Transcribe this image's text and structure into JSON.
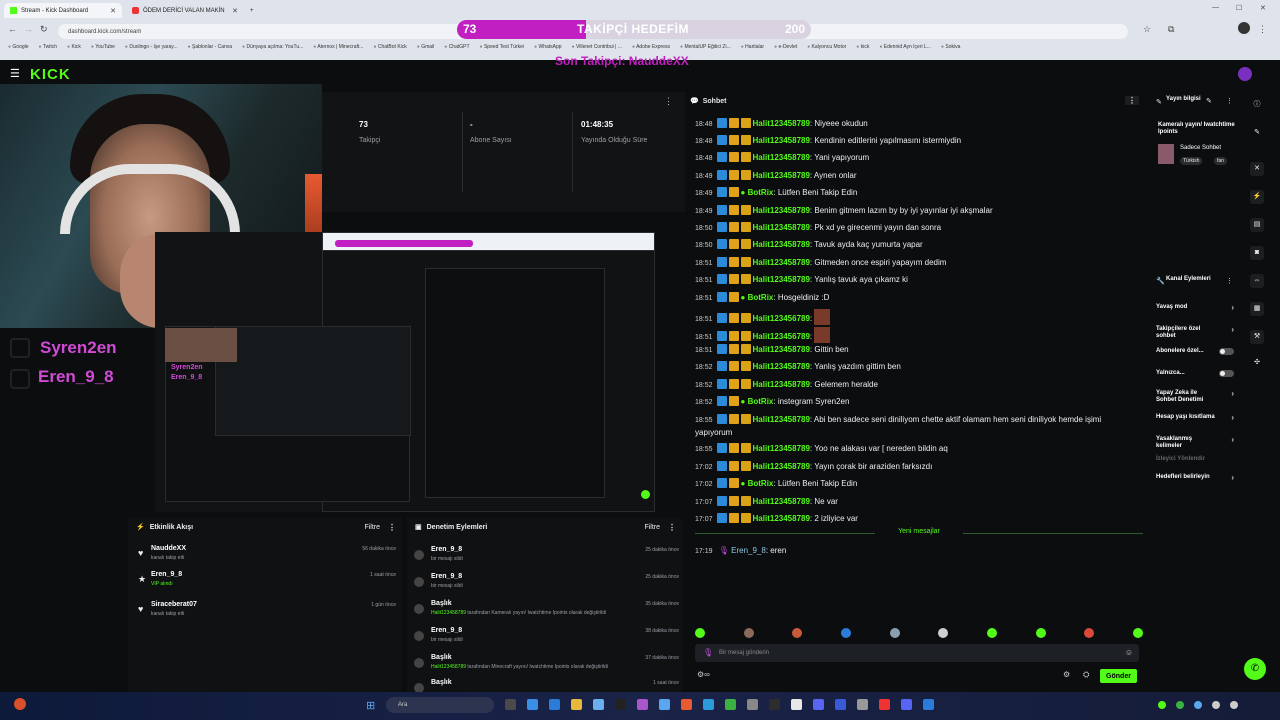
{
  "browser": {
    "tabs": [
      {
        "label": "Stream - Kick Dashboard",
        "active": true
      },
      {
        "label": "ÖDEM DERİCİ VALAN MAKİN",
        "active": false
      }
    ],
    "new_tab": "+",
    "address": "dashboard.kick.com/stream",
    "bookmarks": [
      "Google",
      "Twitch",
      "Kick",
      "YouTube",
      "Duolingo - İşe yaray...",
      "Şablonlar - Canva",
      "Dünyaya açılma: YouTu...",
      "Aternos | Minecraft...",
      "ChatBot Kick",
      "Gmail",
      "ChatGPT",
      "Speed Test Türkei",
      "WhatsApp",
      "Villenet Contribui | ...",
      "Adobe Express",
      "MentalUP Eğitici Zi...",
      "Haritalar",
      "e-Devlet",
      "Kalyoncu Motor",
      "kick",
      "Edennid Ayn İçeri L...",
      "Sokiva"
    ]
  },
  "overlay": {
    "goal_current": "73",
    "goal_label": "TAKİPÇİ HEDEFİM",
    "goal_target": "200",
    "goal_fraction": 0.365,
    "last_follower": "Son Takipçi: NauddeXX",
    "names": [
      "Syren2en",
      "Eren_9_8"
    ]
  },
  "stats": {
    "followers_value": "73",
    "followers_label": "Takipçi",
    "subs_value": "-",
    "subs_label": "Abone Sayısı",
    "uptime_value": "01:48:35",
    "uptime_label": "Yayında Olduğu Süre"
  },
  "activity": {
    "title": "Etkinlik Akışı",
    "filter": "Filtre",
    "items": [
      {
        "name": "NauddeXX",
        "sub": "kanalı takip etti",
        "time": "56 dakika önce",
        "icon": "heart-icon"
      },
      {
        "name": "Eren_9_8",
        "sub": "VIP alındı",
        "time": "1 saat önce",
        "icon": "star-icon"
      },
      {
        "name": "Siraceberat07",
        "sub": "kanalı takip etti",
        "time": "1 gün önce",
        "icon": "heart-icon"
      }
    ]
  },
  "moderation": {
    "title": "Denetim Eylemleri",
    "filter": "Filtre",
    "items": [
      {
        "name": "Eren_9_8",
        "user": "",
        "sub": "bir mesajı sildi",
        "time": "25 dakika önce"
      },
      {
        "name": "Eren_9_8",
        "user": "",
        "sub": "bir mesajı sildi",
        "time": "25 dakika önce"
      },
      {
        "name": "Başlık",
        "user": "Halit123458789",
        "sub": " tarafından Kameralı yayın/ Iwatchtime Ipoints olarak değiştirildi",
        "time": "35 dakika önce"
      },
      {
        "name": "Eren_9_8",
        "user": "",
        "sub": "bir mesajı sildi",
        "time": "38 dakika önce"
      },
      {
        "name": "Başlık",
        "user": "Halit123458789",
        "sub": " tarafından Minecraft yayını/ Iwatchtime Ipoints olarak değiştirildi",
        "time": "37 dakika önce"
      },
      {
        "name": "Başlık",
        "user": "",
        "sub": "",
        "time": "1 saat önce"
      }
    ]
  },
  "chat": {
    "title": "Sohbet",
    "messages": [
      {
        "ts": "18:48",
        "user": "Halit123458789",
        "bot": false,
        "text": ": Niyeee okudun"
      },
      {
        "ts": "18:48",
        "user": "Halit123458789",
        "bot": false,
        "text": ": Kendinin editlerini yapılmasını istermiydin"
      },
      {
        "ts": "18:48",
        "user": "Halit123458789",
        "bot": false,
        "text": ": Yani yapıyorum"
      },
      {
        "ts": "18:49",
        "user": "Halit123458789",
        "bot": false,
        "text": ": Aynen onlar"
      },
      {
        "ts": "18:49",
        "user": "BotRix",
        "bot": true,
        "text": ": Lütfen Beni Takip Edin"
      },
      {
        "ts": "18:49",
        "user": "Halit123458789",
        "bot": false,
        "text": ": Benim gitmem lazım by by iyi yayınlar iyi akşmalar"
      },
      {
        "ts": "18:50",
        "user": "Halit123458789",
        "bot": false,
        "text": ": Pk xd ye girecenmi yayın dan sonra"
      },
      {
        "ts": "18:50",
        "user": "Halit123458789",
        "bot": false,
        "text": ": Tavuk ayda kaç yumurta yapar"
      },
      {
        "ts": "18:51",
        "user": "Halit123458789",
        "bot": false,
        "text": ": Gitmeden once espiri yapayım dedim"
      },
      {
        "ts": "18:51",
        "user": "Halit123458789",
        "bot": false,
        "text": ": Yanlış tavuk aya çıkamz ki"
      },
      {
        "ts": "18:51",
        "user": "BotRix",
        "bot": true,
        "text": ": Hosgeldiniz :D"
      },
      {
        "ts": "18:51",
        "user": "Halit123456789",
        "bot": false,
        "text": ":"
      },
      {
        "ts": "18:51",
        "user": "Halit123456789",
        "bot": false,
        "text": ":"
      },
      {
        "ts": "18:51",
        "user": "Halit123458789",
        "bot": false,
        "text": ": Gittin ben"
      },
      {
        "ts": "18:52",
        "user": "Halit123458789",
        "bot": false,
        "text": ": Yanlış yazdım gittim ben"
      },
      {
        "ts": "18:52",
        "user": "Halit123458789",
        "bot": false,
        "text": ": Gelemem heralde"
      },
      {
        "ts": "18:52",
        "user": "BotRix",
        "bot": true,
        "text": ": instegram Syren2en"
      },
      {
        "ts": "18:55",
        "user": "Halit123458789",
        "bot": false,
        "text": ": Abi ben sadece seni diniliyom chette aktif olamam hem seni diniliyok hemde işimi yapıyorum"
      },
      {
        "ts": "18:55",
        "user": "Halit123458789",
        "bot": false,
        "text": ": Yoo ne alakası var [ nereden bildin aq"
      },
      {
        "ts": "17:02",
        "user": "Halit123458789",
        "bot": false,
        "text": ": Yayın çorak bir araziden farksızdı"
      },
      {
        "ts": "17:02",
        "user": "BotRix",
        "bot": true,
        "text": ": Lütfen Beni Takip Edin"
      },
      {
        "ts": "17:07",
        "user": "Halit123458789",
        "bot": false,
        "text": ": Ne var"
      },
      {
        "ts": "17:07",
        "user": "Halit123458789",
        "bot": false,
        "text": ": 2 izliyice var"
      }
    ],
    "new_messages_label": "Yeni mesajlar",
    "latest": {
      "ts": "17:19",
      "user": "Eren_9_8",
      "text": ": eren"
    },
    "input_placeholder": "Bir mesaj gönderin",
    "send_label": "Gönder",
    "points_label": "∞"
  },
  "stream_info": {
    "title": "Yayın bilgisi",
    "stream_title": "Kameralı yayın/ Iwatchtime Ipoints",
    "category": "Sadece Sohbet",
    "tags": [
      "Türkish",
      "fan"
    ]
  },
  "channel_actions": {
    "title": "Kanal Eylemleri",
    "items": [
      {
        "label": "Yavaş mod",
        "control": "arrow"
      },
      {
        "label": "Takipçilere özel sohbet",
        "control": "arrow"
      },
      {
        "label": "Abonelere özel...",
        "control": "toggle"
      },
      {
        "label": "Yalnızca...",
        "control": "toggle"
      },
      {
        "label": "Yapay Zeka ile Sohbet Denetimi",
        "control": "arrow"
      },
      {
        "label": "Hesap yaşı kısıtlama",
        "control": "arrow"
      },
      {
        "label": "Yasaklanmış kelimeler",
        "control": "arrow"
      },
      {
        "label": "İzleyici Yönlendir",
        "control": "none"
      },
      {
        "label": "Hedefleri belirleyin",
        "control": "arrow"
      }
    ]
  },
  "taskbar": {
    "search_placeholder": "Ara"
  },
  "colors": {
    "kick_green": "#53fc18",
    "overlay_purple": "#c11fc1",
    "overlay_name": "#d24bd6"
  }
}
